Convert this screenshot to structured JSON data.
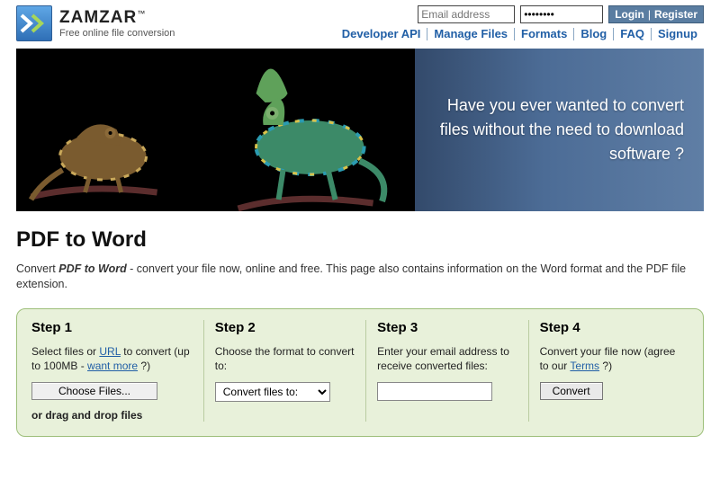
{
  "header": {
    "brand": "ZAMZAR",
    "tm": "™",
    "tagline": "Free online file conversion",
    "email_placeholder": "Email address",
    "password_value": "••••••••",
    "login_label": "Login",
    "register_label": "Register",
    "nav": [
      "Developer API",
      "Manage Files",
      "Formats",
      "Blog",
      "FAQ",
      "Signup"
    ]
  },
  "hero": {
    "slogan": "Have you ever wanted to convert files without the need to download software ?"
  },
  "page": {
    "title": "PDF to Word",
    "desc_pre": "Convert ",
    "desc_em": "PDF to Word",
    "desc_post": " - convert your file now, online and free. This page also contains information on the Word format and the PDF file extension."
  },
  "steps": {
    "s1": {
      "title": "Step 1",
      "text_pre": "Select files or ",
      "url_link": "URL",
      "text_mid": " to convert (up to 100MB - ",
      "more_link": "want more",
      "text_post": " ?)",
      "choose_label": "Choose Files...",
      "drag_label": "or drag and drop files"
    },
    "s2": {
      "title": "Step 2",
      "text": "Choose the format to convert to:",
      "select_label": "Convert files to:"
    },
    "s3": {
      "title": "Step 3",
      "text": "Enter your email address to receive converted files:"
    },
    "s4": {
      "title": "Step 4",
      "text_pre": "Convert your file now (agree to our ",
      "terms_link": "Terms",
      "text_post": " ?)",
      "convert_label": "Convert"
    }
  }
}
